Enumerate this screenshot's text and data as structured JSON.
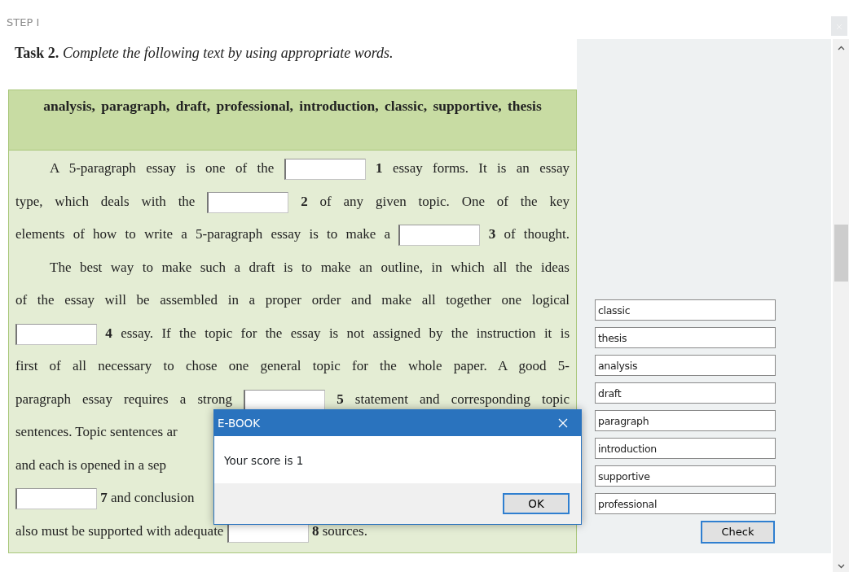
{
  "step": {
    "title": "STEP I"
  },
  "task": {
    "label": "Task 2.",
    "instruction": "Complete the following text by using appropriate words."
  },
  "word_bank": "analysis, paragraph, draft, professional, introduction, classic, supportive, thesis",
  "text_lines": [
    {
      "kind": "full",
      "paragraph_start": true,
      "items": [
        {
          "kind": "text",
          "text": "A 5-paragraph essay is one of the"
        },
        {
          "kind": "blank",
          "number": "1"
        },
        {
          "kind": "text",
          "text": "essay forms. It is an essay"
        }
      ]
    },
    {
      "kind": "full",
      "paragraph_start": false,
      "items": [
        {
          "kind": "text",
          "text": "type, which deals with the"
        },
        {
          "kind": "blank",
          "number": "2"
        },
        {
          "kind": "text",
          "text": "of any given topic. One of the key"
        }
      ]
    },
    {
      "kind": "full",
      "paragraph_start": false,
      "items": [
        {
          "kind": "text",
          "text": "elements of how to write a 5-paragraph essay is to make a"
        },
        {
          "kind": "blank",
          "number": "3"
        },
        {
          "kind": "text",
          "text": "of thought."
        }
      ]
    },
    {
      "kind": "full",
      "paragraph_start": true,
      "items": [
        {
          "kind": "text",
          "text": "The best way to make such a draft is to make an outline, in which all the ideas"
        }
      ]
    },
    {
      "kind": "full",
      "paragraph_start": false,
      "items": [
        {
          "kind": "text",
          "text": "of the essay will be assembled in a proper order and make all together one logical"
        }
      ]
    },
    {
      "kind": "full",
      "paragraph_start": false,
      "items": [
        {
          "kind": "blank",
          "number": "4"
        },
        {
          "kind": "text",
          "text": "essay. If the topic for the essay is not assigned by the instruction it is"
        }
      ]
    },
    {
      "kind": "full",
      "paragraph_start": false,
      "items": [
        {
          "kind": "text",
          "text": "first of all necessary to chose one general topic for the whole paper. A good 5-"
        }
      ]
    },
    {
      "kind": "full",
      "paragraph_start": false,
      "items": [
        {
          "kind": "text",
          "text": "paragraph essay requires a strong"
        },
        {
          "kind": "blank",
          "number": "5"
        },
        {
          "kind": "text",
          "text": "statement and corresponding topic"
        }
      ]
    },
    {
      "kind": "cut",
      "paragraph_start": false,
      "items": [
        {
          "kind": "text",
          "text": "sentences. Topic sentences ar"
        }
      ]
    },
    {
      "kind": "cut",
      "paragraph_start": false,
      "items": [
        {
          "kind": "text",
          "text": "and each is opened in a sep"
        }
      ]
    },
    {
      "kind": "cut",
      "paragraph_start": false,
      "items": [
        {
          "kind": "blank",
          "number": "7"
        },
        {
          "kind": "text",
          "text": "and conclusion"
        }
      ]
    },
    {
      "kind": "cut",
      "paragraph_start": false,
      "items": [
        {
          "kind": "text",
          "text": "also must be supported with adequate"
        },
        {
          "kind": "blank",
          "number": "8"
        },
        {
          "kind": "text",
          "text": "sources."
        }
      ]
    }
  ],
  "answers": [
    {
      "value": "classic"
    },
    {
      "value": "thesis"
    },
    {
      "value": "analysis"
    },
    {
      "value": "draft"
    },
    {
      "value": "paragraph"
    },
    {
      "value": "introduction"
    },
    {
      "value": "supportive"
    },
    {
      "value": "professional"
    }
  ],
  "check_button": "Check",
  "dialog": {
    "title": "E-BOOK",
    "message": "Your score is 1",
    "button": "OK"
  }
}
